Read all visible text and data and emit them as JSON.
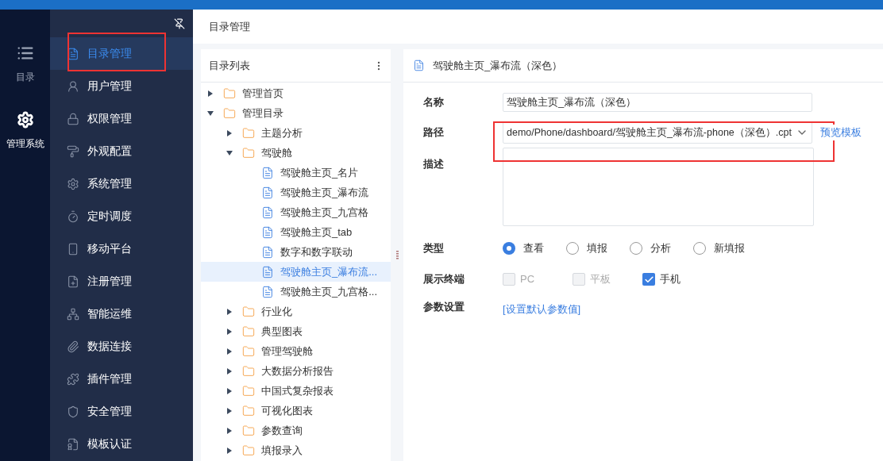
{
  "rail": [
    {
      "label": "目录",
      "selected": false
    },
    {
      "label": "管理系统",
      "selected": true
    }
  ],
  "sidebar": {
    "items": [
      {
        "label": "目录管理",
        "selected": true
      },
      {
        "label": "用户管理",
        "selected": false
      },
      {
        "label": "权限管理",
        "selected": false
      },
      {
        "label": "外观配置",
        "selected": false
      },
      {
        "label": "系统管理",
        "selected": false
      },
      {
        "label": "定时调度",
        "selected": false
      },
      {
        "label": "移动平台",
        "selected": false
      },
      {
        "label": "注册管理",
        "selected": false
      },
      {
        "label": "智能运维",
        "selected": false
      },
      {
        "label": "数据连接",
        "selected": false
      },
      {
        "label": "插件管理",
        "selected": false
      },
      {
        "label": "安全管理",
        "selected": false
      },
      {
        "label": "模板认证",
        "selected": false
      }
    ]
  },
  "page_title": "目录管理",
  "tree": {
    "title": "目录列表",
    "items": [
      {
        "label": "管理首页",
        "kind": "folder",
        "expanded": false,
        "selected": false
      },
      {
        "label": "管理目录",
        "kind": "folder",
        "expanded": true,
        "selected": false,
        "children": [
          {
            "label": "主题分析",
            "kind": "folder",
            "expanded": false,
            "selected": false
          },
          {
            "label": "驾驶舱",
            "kind": "folder",
            "expanded": true,
            "selected": false,
            "children": [
              {
                "label": "驾驶舱主页_名片",
                "kind": "file",
                "selected": false
              },
              {
                "label": "驾驶舱主页_瀑布流",
                "kind": "file",
                "selected": false
              },
              {
                "label": "驾驶舱主页_九宫格",
                "kind": "file",
                "selected": false
              },
              {
                "label": "驾驶舱主页_tab",
                "kind": "file",
                "selected": false
              },
              {
                "label": "数字和数字联动",
                "kind": "file",
                "selected": false
              },
              {
                "label": "驾驶舱主页_瀑布流...",
                "kind": "file",
                "selected": true
              },
              {
                "label": "驾驶舱主页_九宫格...",
                "kind": "file",
                "selected": false
              }
            ]
          },
          {
            "label": "行业化",
            "kind": "folder",
            "expanded": false,
            "selected": false
          },
          {
            "label": "典型图表",
            "kind": "folder",
            "expanded": false,
            "selected": false
          },
          {
            "label": "管理驾驶舱",
            "kind": "folder",
            "expanded": false,
            "selected": false
          },
          {
            "label": "大数据分析报告",
            "kind": "folder",
            "expanded": false,
            "selected": false
          },
          {
            "label": "中国式复杂报表",
            "kind": "folder",
            "expanded": false,
            "selected": false
          },
          {
            "label": "可视化图表",
            "kind": "folder",
            "expanded": false,
            "selected": false
          },
          {
            "label": "参数查询",
            "kind": "folder",
            "expanded": false,
            "selected": false
          },
          {
            "label": "填报录入",
            "kind": "folder",
            "expanded": false,
            "selected": false
          }
        ]
      }
    ]
  },
  "detail": {
    "title": "驾驶舱主页_瀑布流（深色）",
    "name": {
      "label": "名称",
      "value": "驾驶舱主页_瀑布流（深色）"
    },
    "path": {
      "label": "路径",
      "value": "demo/Phone/dashboard/驾驶舱主页_瀑布流-phone（深色）.cpt",
      "link": "预览模板"
    },
    "description": {
      "label": "描述"
    },
    "type": {
      "label": "类型",
      "options": [
        {
          "label": "查看",
          "selected": true
        },
        {
          "label": "填报",
          "selected": false
        },
        {
          "label": "分析",
          "selected": false
        },
        {
          "label": "新填报",
          "selected": false
        }
      ]
    },
    "terminals": {
      "label": "展示终端",
      "options": [
        {
          "label": "PC",
          "checked": false,
          "disabled": true
        },
        {
          "label": "平板",
          "checked": false,
          "disabled": true
        },
        {
          "label": "手机",
          "checked": true,
          "disabled": false
        }
      ]
    },
    "params": {
      "label": "参数设置",
      "link": "[设置默认参数值]"
    }
  }
}
